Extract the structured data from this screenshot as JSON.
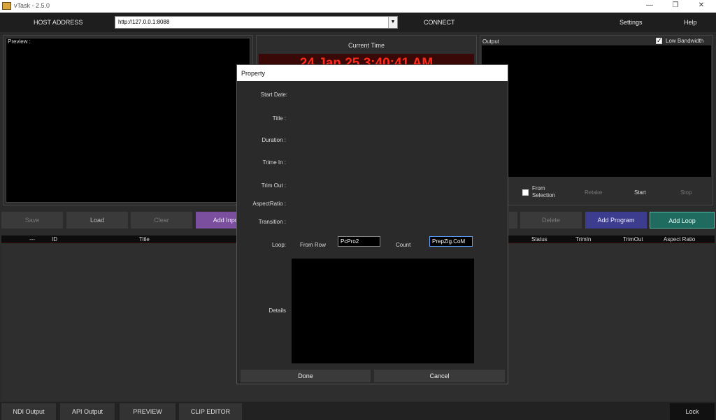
{
  "window": {
    "title": "vTask - 2.5.0",
    "minimize": "—",
    "restore": "❐",
    "close": "✕"
  },
  "topbar": {
    "host_label": "HOST ADDRESS",
    "url_value": "http://127.0.0.1:8088",
    "connect": "CONNECT",
    "settings": "Settings",
    "help": "Help"
  },
  "preview": {
    "label": "Preview :"
  },
  "clock": {
    "label": "Current Time",
    "time": "24 Jan 25 3:40:41 AM"
  },
  "output": {
    "label": "Output",
    "low_bandwidth": "Low Bandwidth"
  },
  "controls": {
    "from_selection": "From Selection",
    "retake": "Retake",
    "start": "Start",
    "stop": "Stop"
  },
  "left_buttons": {
    "save": "Save",
    "load": "Load",
    "clear": "Clear",
    "add_input": "Add Input"
  },
  "right_buttons": {
    "delete": "Delete",
    "add_program": "Add Program",
    "add_loop": "Add Loop"
  },
  "table_headers_left": {
    "dash": "---",
    "id": "ID",
    "title": "Title"
  },
  "table_headers_right": {
    "status": "Status",
    "trimin": "TrimIn",
    "trimout": "TrimOut",
    "aspect": "Aspect Ratio"
  },
  "dialog": {
    "title": "Property",
    "start_date": "Start Date:",
    "title_label": "Title :",
    "duration": "Duration :",
    "trim_in": "Trime In :",
    "trim_out": "Trim Out :",
    "aspect_ratio": "AspectRatio :",
    "transition": "Transition :",
    "loop": "Loop:",
    "from_row": "From Row",
    "from_row_value": "PcPro2",
    "count": "Count",
    "count_value": "PrepZig.CoM",
    "details": "Details",
    "done": "Done",
    "cancel": "Cancel"
  },
  "bottom_tabs": {
    "ndi": "NDI Output",
    "api": "API Output",
    "preview": "PREVIEW",
    "clip": "CLIP EDITOR",
    "lock": "Lock"
  },
  "colors": {
    "clock_red": "#ff2a1a",
    "purple": "#7c4f9e",
    "indigo": "#3d3d8f",
    "teal": "#1f6b60"
  }
}
